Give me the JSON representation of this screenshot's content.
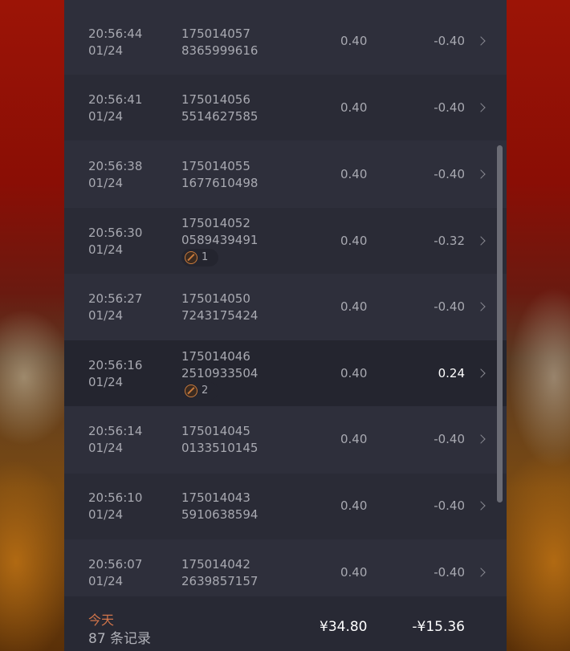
{
  "history": {
    "rows": [
      {
        "time": "20:56:44",
        "date": "01/24",
        "order_line1": "175014057",
        "order_line2": "8365999616",
        "bet": "0.40",
        "win": "-0.40"
      },
      {
        "time": "20:56:41",
        "date": "01/24",
        "order_line1": "175014056",
        "order_line2": "5514627585",
        "bet": "0.40",
        "win": "-0.40"
      },
      {
        "time": "20:56:38",
        "date": "01/24",
        "order_line1": "175014055",
        "order_line2": "1677610498",
        "bet": "0.40",
        "win": "-0.40"
      },
      {
        "time": "20:56:30",
        "date": "01/24",
        "order_line1": "175014052",
        "order_line2": "0589439491",
        "bet": "0.40",
        "win": "-0.32",
        "badge": "1"
      },
      {
        "time": "20:56:27",
        "date": "01/24",
        "order_line1": "175014050",
        "order_line2": "7243175424",
        "bet": "0.40",
        "win": "-0.40"
      },
      {
        "time": "20:56:16",
        "date": "01/24",
        "order_line1": "175014046",
        "order_line2": "2510933504",
        "bet": "0.40",
        "win": "0.24",
        "badge": "2"
      },
      {
        "time": "20:56:14",
        "date": "01/24",
        "order_line1": "175014045",
        "order_line2": "0133510145",
        "bet": "0.40",
        "win": "-0.40"
      },
      {
        "time": "20:56:10",
        "date": "01/24",
        "order_line1": "175014043",
        "order_line2": "5910638594",
        "bet": "0.40",
        "win": "-0.40"
      },
      {
        "time": "20:56:07",
        "date": "01/24",
        "order_line1": "175014042",
        "order_line2": "2639857157",
        "bet": "0.40",
        "win": "-0.40"
      }
    ]
  },
  "footer": {
    "period_label": "今天",
    "record_count": "87 条记录",
    "total_bet": "¥34.80",
    "total_win": "-¥15.36"
  },
  "colors": {
    "panel": "#2e2f3b",
    "accent": "#d0744a",
    "positive_win": "#ffffff"
  },
  "icons": {
    "row_chevron": "chevron-right-icon",
    "feature_badge": "free-spin-icon"
  }
}
